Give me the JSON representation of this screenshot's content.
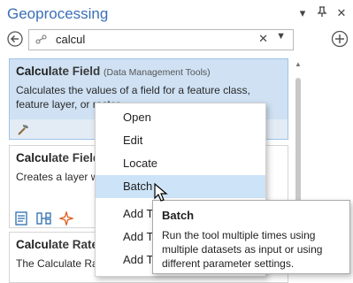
{
  "pane": {
    "title": "Geoprocessing",
    "buttons": {
      "options": "▾",
      "pin": "⊥",
      "close": "✕"
    }
  },
  "search": {
    "value": "calcul",
    "placeholder": ""
  },
  "results": [
    {
      "title_match": "Calcul",
      "title_rest": "ate Field",
      "toolbox": "(Data Management Tools)",
      "description": "Calculates the values of a field for a feature class, feature layer, or raster.",
      "selected": true,
      "footer_icons": [
        "hammer-icon"
      ]
    },
    {
      "title_match": "Calcul",
      "title_rest": "ate Field",
      "toolbox": "",
      "description": "Creates a layer w",
      "selected": false,
      "footer_icons": [
        "document-icon",
        "model-icon",
        "sparkle-icon"
      ]
    },
    {
      "title_match": "Calcul",
      "title_rest": "ate Rate",
      "toolbox": "",
      "description": "The Calculate Rat methods to calcu",
      "selected": false,
      "footer_icons": []
    }
  ],
  "context_menu": {
    "items": [
      {
        "label": "Open",
        "hover": false
      },
      {
        "label": "Edit",
        "hover": false
      },
      {
        "label": "Locate",
        "hover": false
      },
      {
        "label": "Batch",
        "hover": true
      },
      {
        "label": "Add To",
        "hover": false
      },
      {
        "label": "Add To",
        "hover": false
      },
      {
        "label": "Add To",
        "hover": false
      }
    ]
  },
  "tooltip": {
    "title": "Batch",
    "description": "Run the tool multiple times using multiple datasets as input or using different parameter settings."
  },
  "colors": {
    "title_blue": "#3a6fb8",
    "selected_card": "#cfe1f3",
    "menu_hover": "#cde3f7"
  }
}
